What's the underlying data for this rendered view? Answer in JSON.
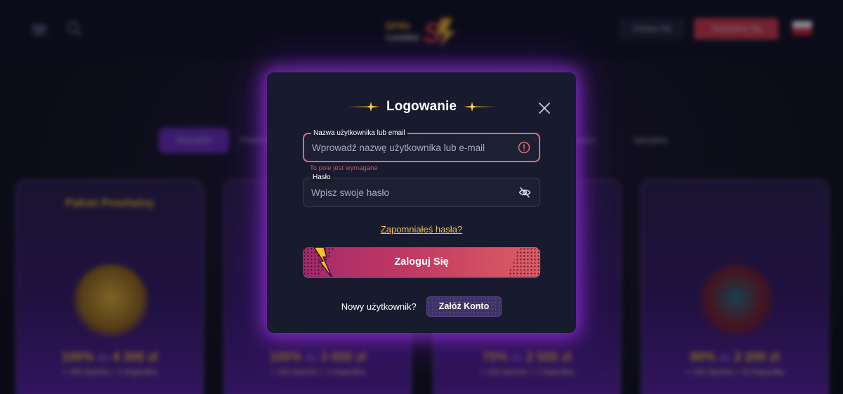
{
  "background": {
    "header": {
      "login_label": "Zaloguj Się",
      "register_label": "Zarejestruj Się"
    },
    "tabs": [
      "Wszystkie",
      "Powitalne",
      "",
      "",
      "",
      "Kasyno",
      "Specjalne"
    ],
    "promos": [
      {
        "title": "Pakiet Powitalny",
        "subtitle": "",
        "bonus_pct": "100%",
        "bonus_do": "do",
        "bonus_amount": "4 300 zł",
        "spins": "+ 200 Spinów + 1 Kapsułka"
      },
      {
        "title": "",
        "subtitle": "",
        "bonus_pct": "100%",
        "bonus_do": "do",
        "bonus_amount": "3 000 zł",
        "spins": "+ 100 Spinów + 1 Kapsułka"
      },
      {
        "title": "",
        "subtitle": "",
        "bonus_pct": "70%",
        "bonus_do": "do",
        "bonus_amount": "2 500 zł",
        "spins": "+ 100 Spinów + 1 Kapsułka"
      },
      {
        "title": "",
        "subtitle": "",
        "bonus_pct": "80%",
        "bonus_do": "do",
        "bonus_amount": "2 200 zł",
        "spins": "+ 100 Spinów + 10 Kapsułka"
      }
    ]
  },
  "modal": {
    "title": "Logowanie",
    "username": {
      "label": "Nazwa użytkownika lub email",
      "placeholder": "Wprowadź nazwę użytkownika lub e-mail",
      "value": "",
      "error": "To pole jest wymagane"
    },
    "password": {
      "label": "Hasło",
      "placeholder": "Wpisz swoje hasło",
      "value": ""
    },
    "forgot_link": "Zapomniałeś hasła?",
    "submit_label": "Zaloguj Się",
    "new_user_text": "Nowy użytkownik?",
    "create_account_label": "Załóż Konto"
  },
  "colors": {
    "accent_gold": "#f2c14e",
    "error_red": "#e26a7c",
    "button_start": "#a42a6b",
    "button_end": "#dc5f63",
    "glow_purple": "#9632dc"
  },
  "icons": [
    "gift-icon",
    "search-icon",
    "close-icon",
    "error-icon",
    "eye-off-icon",
    "lightning-bolt-icon",
    "sparkle-icon"
  ]
}
